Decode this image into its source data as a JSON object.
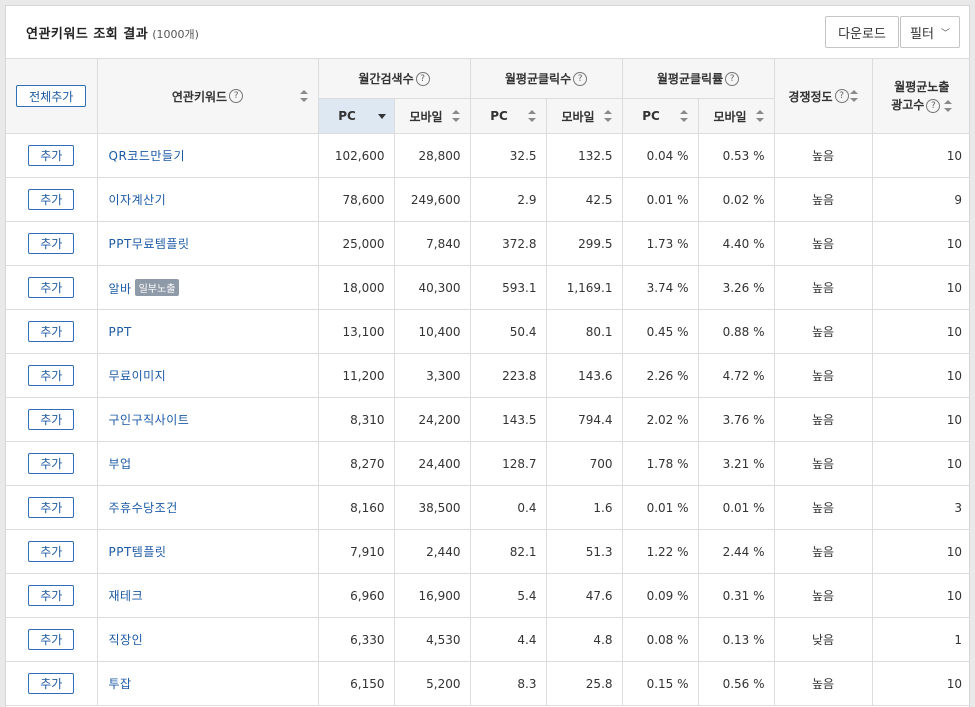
{
  "header": {
    "title": "연관키워드 조회 결과",
    "count": "(1000개)",
    "download_label": "다운로드",
    "filter_label": "필터",
    "filter_chevron": "﹀"
  },
  "table": {
    "add_all_label": "전체추가",
    "col_keyword": "연관키워드",
    "col_monthly_search": "월간검색수",
    "col_monthly_clicks": "월평균클릭수",
    "col_monthly_ctr": "월평균클릭률",
    "col_competition": "경쟁정도",
    "col_ads_line1": "월평균노출",
    "col_ads_line2": "광고수",
    "sub_pc": "PC",
    "sub_mobile": "모바일",
    "help_glyph": "?",
    "add_label": "추가",
    "rows": [
      {
        "keyword": "QR코드만들기",
        "badge": "",
        "search_pc": "102,600",
        "search_mobile": "28,800",
        "clicks_pc": "32.5",
        "clicks_mobile": "132.5",
        "ctr_pc": "0.04 %",
        "ctr_mobile": "0.53 %",
        "competition": "높음",
        "ads": "10"
      },
      {
        "keyword": "이자계산기",
        "badge": "",
        "search_pc": "78,600",
        "search_mobile": "249,600",
        "clicks_pc": "2.9",
        "clicks_mobile": "42.5",
        "ctr_pc": "0.01 %",
        "ctr_mobile": "0.02 %",
        "competition": "높음",
        "ads": "9"
      },
      {
        "keyword": "PPT무료템플릿",
        "badge": "",
        "search_pc": "25,000",
        "search_mobile": "7,840",
        "clicks_pc": "372.8",
        "clicks_mobile": "299.5",
        "ctr_pc": "1.73 %",
        "ctr_mobile": "4.40 %",
        "competition": "높음",
        "ads": "10"
      },
      {
        "keyword": "알바",
        "badge": "일부노출",
        "search_pc": "18,000",
        "search_mobile": "40,300",
        "clicks_pc": "593.1",
        "clicks_mobile": "1,169.1",
        "ctr_pc": "3.74 %",
        "ctr_mobile": "3.26 %",
        "competition": "높음",
        "ads": "10"
      },
      {
        "keyword": "PPT",
        "badge": "",
        "search_pc": "13,100",
        "search_mobile": "10,400",
        "clicks_pc": "50.4",
        "clicks_mobile": "80.1",
        "ctr_pc": "0.45 %",
        "ctr_mobile": "0.88 %",
        "competition": "높음",
        "ads": "10"
      },
      {
        "keyword": "무료이미지",
        "badge": "",
        "search_pc": "11,200",
        "search_mobile": "3,300",
        "clicks_pc": "223.8",
        "clicks_mobile": "143.6",
        "ctr_pc": "2.26 %",
        "ctr_mobile": "4.72 %",
        "competition": "높음",
        "ads": "10"
      },
      {
        "keyword": "구인구직사이트",
        "badge": "",
        "search_pc": "8,310",
        "search_mobile": "24,200",
        "clicks_pc": "143.5",
        "clicks_mobile": "794.4",
        "ctr_pc": "2.02 %",
        "ctr_mobile": "3.76 %",
        "competition": "높음",
        "ads": "10"
      },
      {
        "keyword": "부업",
        "badge": "",
        "search_pc": "8,270",
        "search_mobile": "24,400",
        "clicks_pc": "128.7",
        "clicks_mobile": "700",
        "ctr_pc": "1.78 %",
        "ctr_mobile": "3.21 %",
        "competition": "높음",
        "ads": "10"
      },
      {
        "keyword": "주휴수당조건",
        "badge": "",
        "search_pc": "8,160",
        "search_mobile": "38,500",
        "clicks_pc": "0.4",
        "clicks_mobile": "1.6",
        "ctr_pc": "0.01 %",
        "ctr_mobile": "0.01 %",
        "competition": "높음",
        "ads": "3"
      },
      {
        "keyword": "PPT템플릿",
        "badge": "",
        "search_pc": "7,910",
        "search_mobile": "2,440",
        "clicks_pc": "82.1",
        "clicks_mobile": "51.3",
        "ctr_pc": "1.22 %",
        "ctr_mobile": "2.44 %",
        "competition": "높음",
        "ads": "10"
      },
      {
        "keyword": "재테크",
        "badge": "",
        "search_pc": "6,960",
        "search_mobile": "16,900",
        "clicks_pc": "5.4",
        "clicks_mobile": "47.6",
        "ctr_pc": "0.09 %",
        "ctr_mobile": "0.31 %",
        "competition": "높음",
        "ads": "10"
      },
      {
        "keyword": "직장인",
        "badge": "",
        "search_pc": "6,330",
        "search_mobile": "4,530",
        "clicks_pc": "4.4",
        "clicks_mobile": "4.8",
        "ctr_pc": "0.08 %",
        "ctr_mobile": "0.13 %",
        "competition": "낮음",
        "ads": "1"
      },
      {
        "keyword": "투잡",
        "badge": "",
        "search_pc": "6,150",
        "search_mobile": "5,200",
        "clicks_pc": "8.3",
        "clicks_mobile": "25.8",
        "ctr_pc": "0.15 %",
        "ctr_mobile": "0.56 %",
        "competition": "높음",
        "ads": "10"
      }
    ]
  },
  "colors": {
    "link": "#1c5aa6",
    "sorted_header_bg": "#dde8f2",
    "badge_bg": "#8f9aa8"
  }
}
